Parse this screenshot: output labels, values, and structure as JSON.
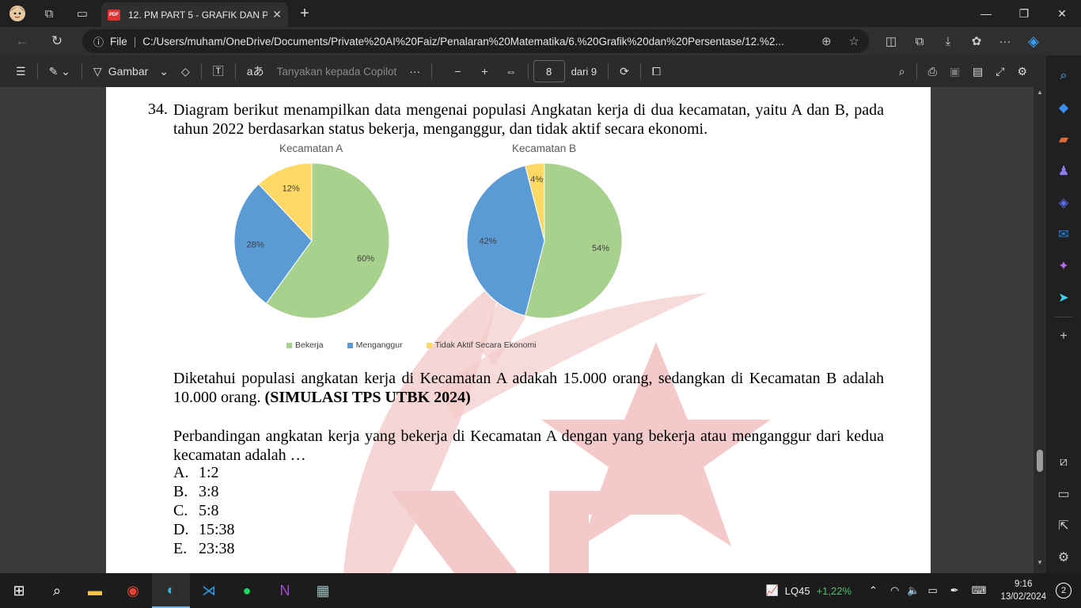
{
  "browser": {
    "tab_title": "12. PM PART 5 - GRAFIK DAN PE",
    "tab_badge": "PDF",
    "url_prefix": "File",
    "url": "C:/Users/muham/OneDrive/Documents/Private%20AI%20Faiz/Penalaran%20Matematika/6.%20Grafik%20dan%20Persentase/12.%2..."
  },
  "pdf_toolbar": {
    "draw_label": "Gambar",
    "copilot_label": "Tanyakan kepada Copilot",
    "page_current": "8",
    "page_total": "dari 9"
  },
  "document": {
    "question_number": "34.",
    "question_intro": "Diagram berikut menampilkan data mengenai populasi Angkatan kerja di dua kecamatan, yaitu A dan B, pada tahun 2022 berdasarkan status bekerja, menganggur, dan tidak aktif secara ekonomi.",
    "info_text": "Diketahui populasi angkatan kerja di Kecamatan A adakah 15.000 orang, sedangkan di Kecamatan B adalah 10.000 orang. ",
    "info_bold": "(SIMULASI TPS UTBK 2024)",
    "question_text": "Perbandingan angkatan kerja yang bekerja di Kecamatan A dengan yang bekerja atau menganggur dari kedua kecamatan adalah …",
    "options": [
      {
        "letter": "A.",
        "text": "1:2"
      },
      {
        "letter": "B.",
        "text": "3:8"
      },
      {
        "letter": "C.",
        "text": "5:8"
      },
      {
        "letter": "D.",
        "text": "15:38"
      },
      {
        "letter": "E.",
        "text": "23:38"
      }
    ]
  },
  "chart_data": [
    {
      "type": "pie",
      "title": "Kecamatan A",
      "categories": [
        "Bekerja",
        "Menganggur",
        "Tidak Aktif Secara Ekonomi"
      ],
      "values": [
        60,
        28,
        12
      ],
      "labels": [
        "60%",
        "28%",
        "12%"
      ],
      "colors": [
        "#a9d18e",
        "#5b9bd5",
        "#ffd966"
      ]
    },
    {
      "type": "pie",
      "title": "Kecamatan B",
      "categories": [
        "Bekerja",
        "Menganggur",
        "Tidak Aktif Secara Ekonomi"
      ],
      "values": [
        54,
        42,
        4
      ],
      "labels": [
        "54%",
        "42%",
        "4%"
      ],
      "colors": [
        "#a9d18e",
        "#5b9bd5",
        "#ffd966"
      ]
    }
  ],
  "legend": [
    {
      "label": "Bekerja",
      "color": "#a9d18e"
    },
    {
      "label": "Menganggur",
      "color": "#5b9bd5"
    },
    {
      "label": "Tidak Aktif Secara Ekonomi",
      "color": "#ffd966"
    }
  ],
  "taskbar": {
    "stock_name": "LQ45",
    "stock_change": "+1,22%",
    "time": "9:16",
    "date": "13/02/2024",
    "notification_count": "2"
  },
  "colors": {
    "stock_up": "#4cc26a",
    "accent": "#6cb8f6"
  }
}
